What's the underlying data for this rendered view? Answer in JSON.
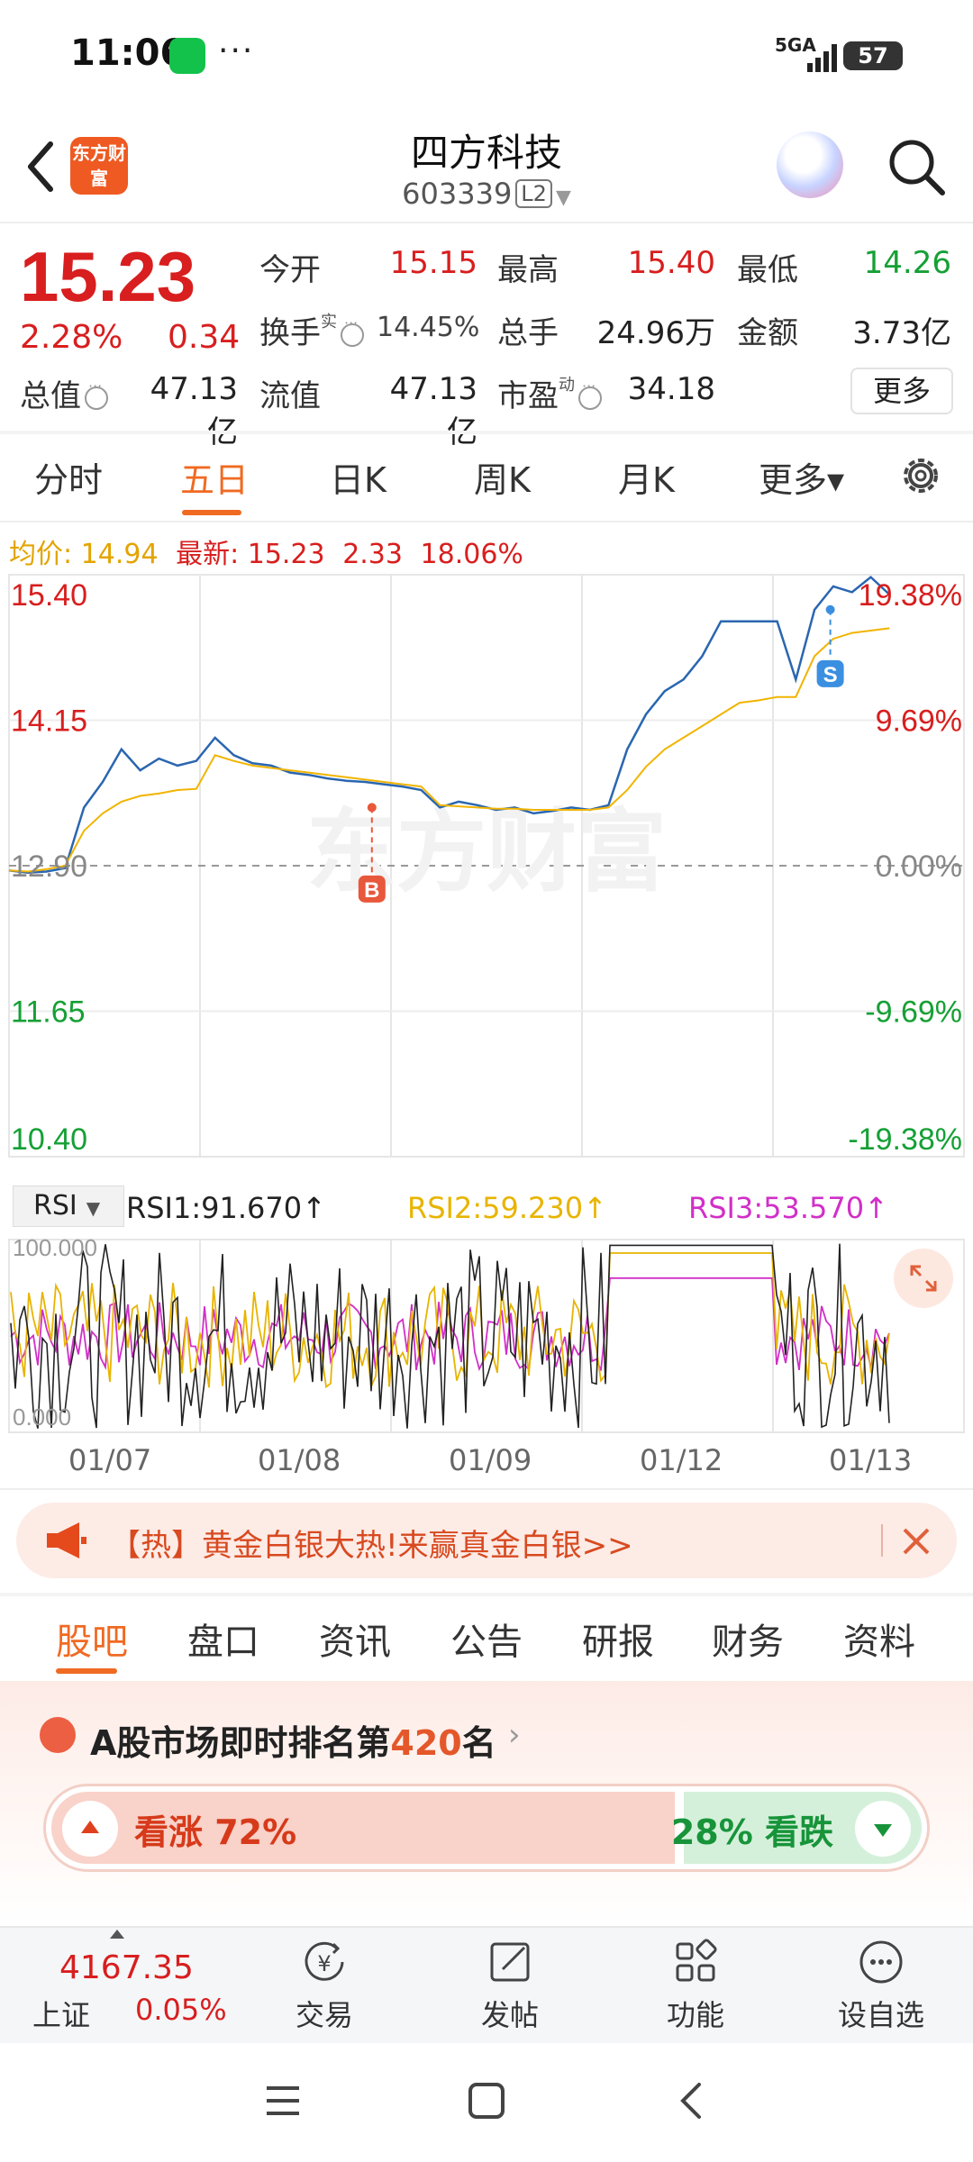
{
  "status_bar": {
    "time": "11:06",
    "dots": "···",
    "network": "5GA",
    "battery": "57"
  },
  "header": {
    "stock_name": "四方科技",
    "stock_code": "603339",
    "level_badge": "L2",
    "logo_text": "东方财富"
  },
  "quote": {
    "price": "15.23",
    "change_pct": "2.28%",
    "change_amt": "0.34",
    "open_label": "今开",
    "open": "15.15",
    "high_label": "最高",
    "high": "15.40",
    "low_label": "最低",
    "low": "14.26",
    "turnover_label": "换手",
    "turnover_sup": "实",
    "turnover": "14.45%",
    "volume_label": "总手",
    "volume": "24.96万",
    "amount_label": "金额",
    "amount": "3.73亿",
    "mktcap_label": "总值",
    "mktcap": "47.13亿",
    "float_label": "流值",
    "float": "47.13亿",
    "pe_label": "市盈",
    "pe_sup": "动",
    "pe": "34.18",
    "more_label": "更多"
  },
  "chart_tabs": [
    "分时",
    "五日",
    "日K",
    "周K",
    "月K",
    "更多▾"
  ],
  "info_line": {
    "avg_label": "均价:",
    "avg": "14.94",
    "latest_label": "最新:",
    "latest": "15.23",
    "chg": "2.33",
    "pct": "18.06%"
  },
  "chart_data": {
    "type": "line",
    "y_left_ticks": [
      "15.40",
      "14.15",
      "12.90",
      "11.65",
      "10.40"
    ],
    "y_right_ticks": [
      "19.38%",
      "9.69%",
      "0.00%",
      "-9.69%",
      "-19.38%"
    ],
    "ylim": [
      10.4,
      15.4
    ],
    "prev_close": 12.9,
    "days": [
      "01/07",
      "01/08",
      "01/09",
      "01/12",
      "01/13"
    ],
    "series": [
      {
        "values": [
          12.86,
          12.84,
          12.85,
          12.88,
          13.4,
          13.62,
          13.9,
          13.72,
          13.82,
          13.76,
          13.8,
          14.0,
          13.85,
          13.78,
          13.76,
          13.7,
          13.68,
          13.65,
          13.63,
          13.62,
          13.6,
          13.58,
          13.55,
          13.4,
          13.45,
          13.42,
          13.38,
          13.4,
          13.35,
          13.37,
          13.4,
          13.38,
          13.42,
          13.9,
          14.2,
          14.4,
          14.5,
          14.7,
          15.0,
          15.0,
          15.0,
          15.0,
          14.5,
          15.1,
          15.3,
          15.25,
          15.38,
          15.23
        ]
      },
      {
        "values": [
          12.86,
          12.85,
          12.87,
          12.9,
          13.2,
          13.35,
          13.45,
          13.5,
          13.52,
          13.55,
          13.56,
          13.85,
          13.8,
          13.76,
          13.74,
          13.72,
          13.7,
          13.68,
          13.66,
          13.64,
          13.62,
          13.6,
          13.58,
          13.42,
          13.41,
          13.4,
          13.39,
          13.39,
          13.38,
          13.38,
          13.38,
          13.38,
          13.4,
          13.55,
          13.75,
          13.9,
          14.0,
          14.1,
          14.2,
          14.3,
          14.32,
          14.35,
          14.35,
          14.7,
          14.85,
          14.9,
          14.92,
          14.94
        ]
      }
    ],
    "markers": [
      {
        "label": "B",
        "day": "01/08",
        "value": 13.4
      },
      {
        "label": "S",
        "day": "01/13",
        "value": 15.1
      }
    ],
    "watermark": "东方财富"
  },
  "rsi": {
    "dropdown": "RSI",
    "rsi1": "RSI1:91.670↑",
    "rsi2": "RSI2:59.230↑",
    "rsi3": "RSI3:53.570↑",
    "ymax": "100.000",
    "ymin": "0.000",
    "colors": {
      "rsi1": "#222222",
      "rsi2": "#e8b400",
      "rsi3": "#d12fc8"
    }
  },
  "banner": {
    "text": "【热】黄金白银大热!来赢真金白银>>"
  },
  "bottom_tabs": [
    "股吧",
    "盘口",
    "资讯",
    "公告",
    "研报",
    "财务",
    "资料"
  ],
  "rank": {
    "prefix": "A股市场即时排名第",
    "number": "420",
    "suffix": "名"
  },
  "sentiment": {
    "bull_label": "看涨 72%",
    "bear_label": "28% 看跌",
    "bull_ratio": 0.72
  },
  "bottom_nav": {
    "index_value": "4167.35",
    "index_name": "上证",
    "index_pct": "0.05%",
    "items": [
      "交易",
      "发帖",
      "功能",
      "设自选"
    ]
  },
  "colors": {
    "up": "#d81e1e",
    "down": "#15a035",
    "accent": "#f06a22",
    "price_line": "#2a66b0",
    "avg_line": "#f1b400"
  }
}
